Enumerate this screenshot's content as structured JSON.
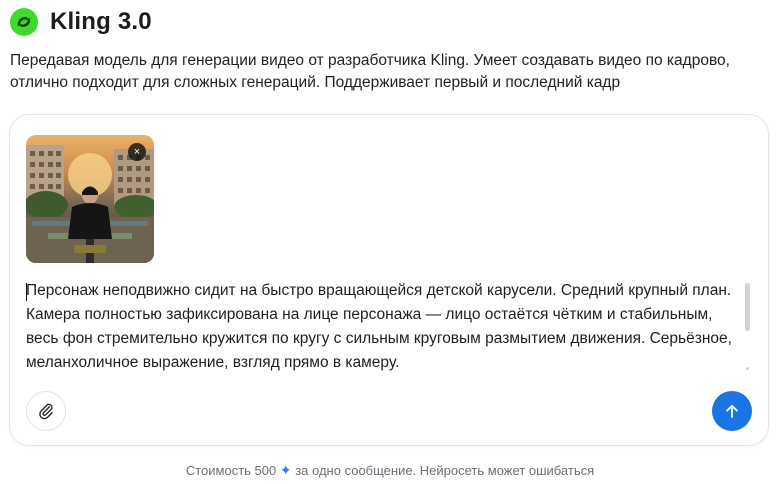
{
  "header": {
    "title": "Kling 3.0",
    "logo_icon": "kling-logo-icon",
    "logo_color": "#3ddc2a"
  },
  "description": "Передавая модель для генерации видео от разработчика Kling. Умеет создавать видео по кадрово, отлично подходит для сложных генераций. Поддерживает первый и последний кадр",
  "composer": {
    "attachment": {
      "kind": "image",
      "remove_label": "×"
    },
    "prompt_text": "Персонаж неподвижно сидит на быстро вращающейся детской карусели. Средний крупный план. Камера полностью зафиксирована на лице персонажа — лицо остаётся чётким и стабильным, весь фон стремительно кружится по кругу с сильным круговым размытием движения. Серьёзное, меланхоличное выражение, взгляд прямо в камеру.",
    "attach_icon": "paperclip-icon",
    "send_icon": "arrow-up-icon",
    "send_color": "#1b74e4"
  },
  "footer": {
    "cost_prefix": "Стоимость 500",
    "spark_icon": "✦",
    "cost_suffix": "за одно сообщение. Нейросеть может ошибаться"
  }
}
